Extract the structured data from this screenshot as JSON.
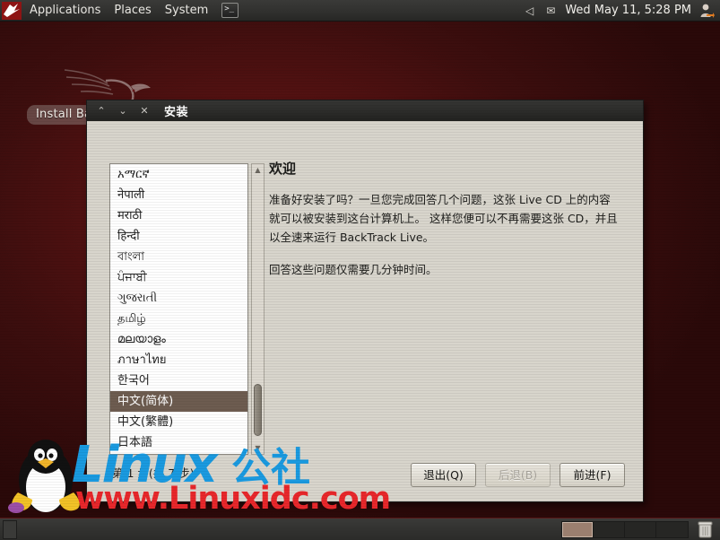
{
  "top_panel": {
    "logo_icon": "backtrack-dragon-icon",
    "menus": [
      {
        "label": "Applications",
        "name": "applications-menu"
      },
      {
        "label": "Places",
        "name": "places-menu"
      },
      {
        "label": "System",
        "name": "system-menu"
      }
    ],
    "terminal_launcher": {
      "glyph": ">_",
      "name": "terminal-launcher"
    },
    "tray": [
      {
        "icon": "volume-icon",
        "glyph": "◁"
      },
      {
        "icon": "mail-icon",
        "glyph": "✉"
      }
    ],
    "clock": "Wed May 11,  5:28 PM",
    "user_icon": "user-avatar-icon"
  },
  "desktop": {
    "launcher_label": "Install Ba",
    "wallpaper_logo": "backtrack-dragon-logo"
  },
  "dialog": {
    "title": "安装",
    "window_buttons": [
      {
        "name": "minimize-button",
        "glyph": "⌃"
      },
      {
        "name": "maximize-button",
        "glyph": "⌄"
      },
      {
        "name": "close-button",
        "glyph": "✕"
      }
    ],
    "language_list": [
      {
        "label": "አማርኛ",
        "selected": false
      },
      {
        "label": "नेपाली",
        "selected": false
      },
      {
        "label": "मराठी",
        "selected": false
      },
      {
        "label": "हिन्दी",
        "selected": false
      },
      {
        "label": "বাংলা",
        "selected": false
      },
      {
        "label": "ਪੰਜਾਬੀ",
        "selected": false
      },
      {
        "label": "ગુજરાતી",
        "selected": false
      },
      {
        "label": "தமிழ்",
        "selected": false
      },
      {
        "label": "മലയാളം",
        "selected": false
      },
      {
        "label": "ภาษาไทย",
        "selected": false
      },
      {
        "label": "한국어",
        "selected": false
      },
      {
        "label": "中文(简体)",
        "selected": true
      },
      {
        "label": "中文(繁體)",
        "selected": false
      },
      {
        "label": "日本語",
        "selected": false
      }
    ],
    "scrollbar": {
      "up_arrow": "▲",
      "down_arrow": "▼"
    },
    "welcome_title": "欢迎",
    "paragraphs": [
      "准备好安装了吗？一旦您完成回答几个问题，这张 Live CD 上的内容就可以被安装到这台计算机上。 这样您便可以不再需要这张 CD，并且以全速来运行 BackTrack Live。",
      "回答这些问题仅需要几分钟时间。"
    ],
    "step_label": "第 1 步(共 7 步)",
    "buttons": [
      {
        "label": "退出(Q)",
        "name": "quit-button",
        "disabled": false
      },
      {
        "label": "后退(B)",
        "name": "back-button",
        "disabled": true
      },
      {
        "label": "前进(F)",
        "name": "forward-button",
        "disabled": false
      }
    ]
  },
  "bottom_panel": {
    "show_desktop_icon": "show-desktop-icon",
    "workspaces": [
      {
        "active": true
      },
      {
        "active": false
      },
      {
        "active": false
      },
      {
        "active": false
      }
    ],
    "trash_icon": "trash-icon"
  },
  "watermark": {
    "brand": "Linux",
    "brand_cn": "公社",
    "url": "www.Linuxidc.com",
    "tux_icon": "tux-penguin-icon"
  },
  "colors": {
    "panel": "#323230",
    "dialog_bg": "#d8d5cc",
    "selection": "#6d5c50",
    "wallpaper": "#551212",
    "watermark_blue": "#1a9ae0",
    "watermark_red": "#e8272b"
  }
}
